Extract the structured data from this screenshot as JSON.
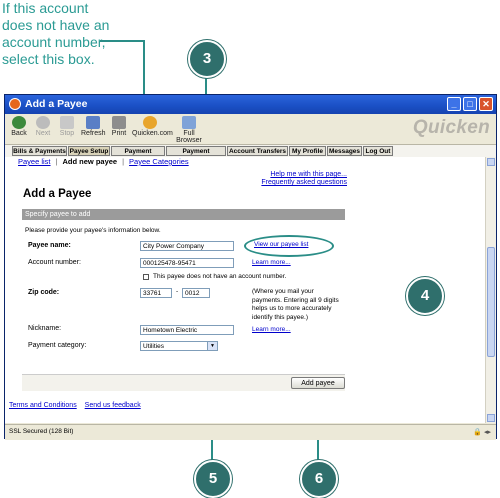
{
  "callout": {
    "lines": [
      "If this account",
      "does not have an",
      "account number,",
      "select this box."
    ]
  },
  "steps": {
    "s3": "3",
    "s4": "4",
    "s5": "5",
    "s6": "6"
  },
  "window": {
    "title": "Add a Payee",
    "brand": "Quicken"
  },
  "toolbar": {
    "back": "Back",
    "next": "Next",
    "stop": "Stop",
    "refresh": "Refresh",
    "print": "Print",
    "quicken_com": "Quicken.com",
    "full_browser": "Full Browser"
  },
  "navtabs": [
    "Bills & Payments",
    "Payee Setup",
    "Payment Activity",
    "Payment Accounts",
    "Account Transfers",
    "My Profile",
    "Messages",
    "Log Out"
  ],
  "subnav": {
    "payee_list": "Payee list",
    "add_new_payee": "Add new payee",
    "payee_categories": "Payee Categories"
  },
  "help": {
    "help_page": "Help me with this page...",
    "faq": "Frequently asked questions"
  },
  "page_title": "Add a Payee",
  "section_title": "Specify payee to add",
  "form": {
    "intro": "Please provide your payee's information below.",
    "payee_name_label": "Payee name:",
    "payee_name_value": "City Power Company",
    "view_payee_list": "View our payee list",
    "account_number_label": "Account number:",
    "account_number_value": "000125478-95471",
    "learn_more": "Learn more...",
    "no_account_label": "This payee does not have an account number.",
    "zip_label": "Zip code:",
    "zip_value": "33761",
    "zip_dash": "-",
    "zip_ext": "0012",
    "zip_help": "(Where you mail your payments. Entering all 9 digits helps us to more accurately identify this payee.)",
    "nickname_label": "Nickname:",
    "nickname_value": "Hometown Electric",
    "learn_more_2": "Learn more...",
    "category_label": "Payment category:",
    "category_value": "Utilities",
    "add_payee": "Add payee"
  },
  "footer": {
    "terms": "Terms and Conditions",
    "feedback": "Send us feedback"
  },
  "status": {
    "text": "SSL Secured (128 Bit)"
  }
}
